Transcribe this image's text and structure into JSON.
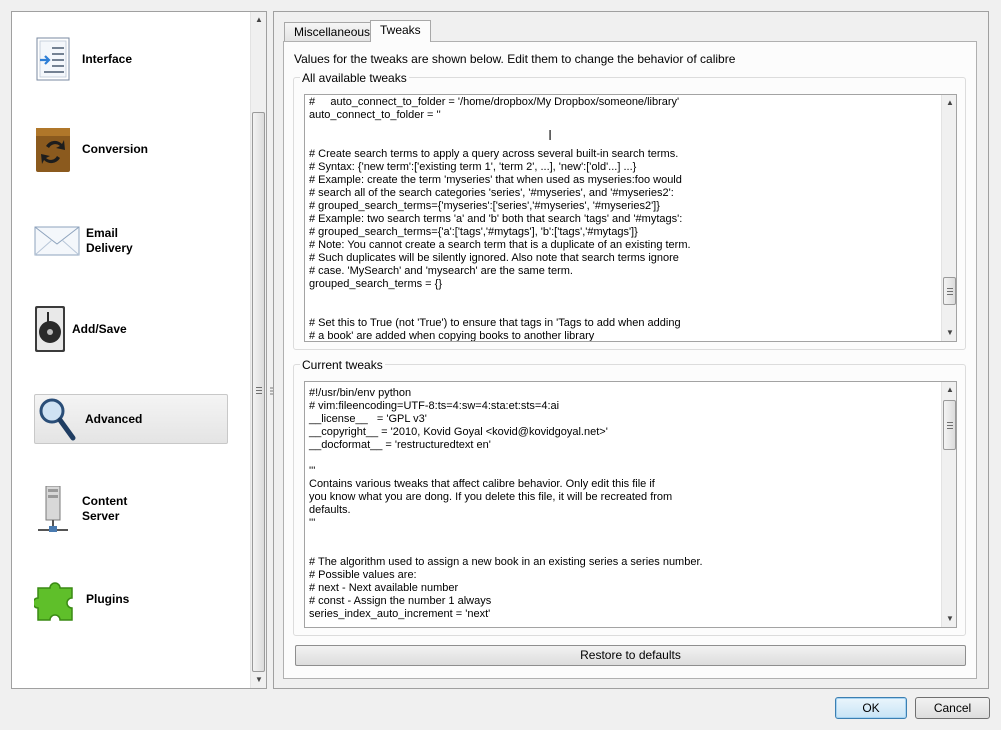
{
  "categories": [
    {
      "label": "Interface",
      "icon": "interface-icon",
      "selected": false
    },
    {
      "label": "Conversion",
      "icon": "conversion-icon",
      "selected": false
    },
    {
      "label": "Email\nDelivery",
      "icon": "email-envelope-icon",
      "selected": false
    },
    {
      "label": "Add/Save",
      "icon": "disk-icon",
      "selected": false
    },
    {
      "label": "Advanced",
      "icon": "magnifier-icon",
      "selected": true
    },
    {
      "label": "Content\nServer",
      "icon": "server-icon",
      "selected": false
    },
    {
      "label": "Plugins",
      "icon": "puzzle-piece-icon",
      "selected": false
    }
  ],
  "tabs": [
    {
      "label": "Miscellaneous",
      "active": false
    },
    {
      "label": "Tweaks",
      "active": true
    }
  ],
  "intro": "Values for the tweaks are shown below. Edit them to change the behavior of calibre",
  "all_tweaks": {
    "title": "All available tweaks",
    "lines": [
      "#     auto_connect_to_folder = '/home/dropbox/My Dropbox/someone/library'",
      "auto_connect_to_folder = ''",
      "",
      "",
      "# Create search terms to apply a query across several built-in search terms.",
      "# Syntax: {'new term':['existing term 1', 'term 2', ...], 'new':['old'...] ...}",
      "# Example: create the term 'myseries' that when used as myseries:foo would",
      "# search all of the search categories 'series', '#myseries', and '#myseries2':",
      "# grouped_search_terms={'myseries':['series','#myseries', '#myseries2']}",
      "# Example: two search terms 'a' and 'b' both that search 'tags' and '#mytags':",
      "# grouped_search_terms={'a':['tags','#mytags'], 'b':['tags','#mytags']}",
      "# Note: You cannot create a search term that is a duplicate of an existing term.",
      "# Such duplicates will be silently ignored. Also note that search terms ignore",
      "# case. 'MySearch' and 'mysearch' are the same term.",
      "grouped_search_terms = {}",
      "",
      "",
      "# Set this to True (not 'True') to ensure that tags in 'Tags to add when adding",
      "# a book' are added when copying books to another library"
    ]
  },
  "current_tweaks": {
    "title": "Current tweaks",
    "lines": [
      "#!/usr/bin/env python",
      "# vim:fileencoding=UTF-8:ts=4:sw=4:sta:et:sts=4:ai",
      "__license__   = 'GPL v3'",
      "__copyright__ = '2010, Kovid Goyal <kovid@kovidgoyal.net>'",
      "__docformat__ = 'restructuredtext en'",
      "",
      "'''",
      "Contains various tweaks that affect calibre behavior. Only edit this file if",
      "you know what you are dong. If you delete this file, it will be recreated from",
      "defaults.",
      "'''",
      "",
      "",
      "# The algorithm used to assign a new book in an existing series a series number.",
      "# Possible values are:",
      "# next - Next available number",
      "# const - Assign the number 1 always",
      "series_index_auto_increment = 'next'"
    ]
  },
  "buttons": {
    "restore": "Restore to defaults",
    "ok": "OK",
    "cancel": "Cancel"
  },
  "colors": {
    "selection_bg": "#e6e6e6",
    "ok_border": "#3c7fb1"
  }
}
